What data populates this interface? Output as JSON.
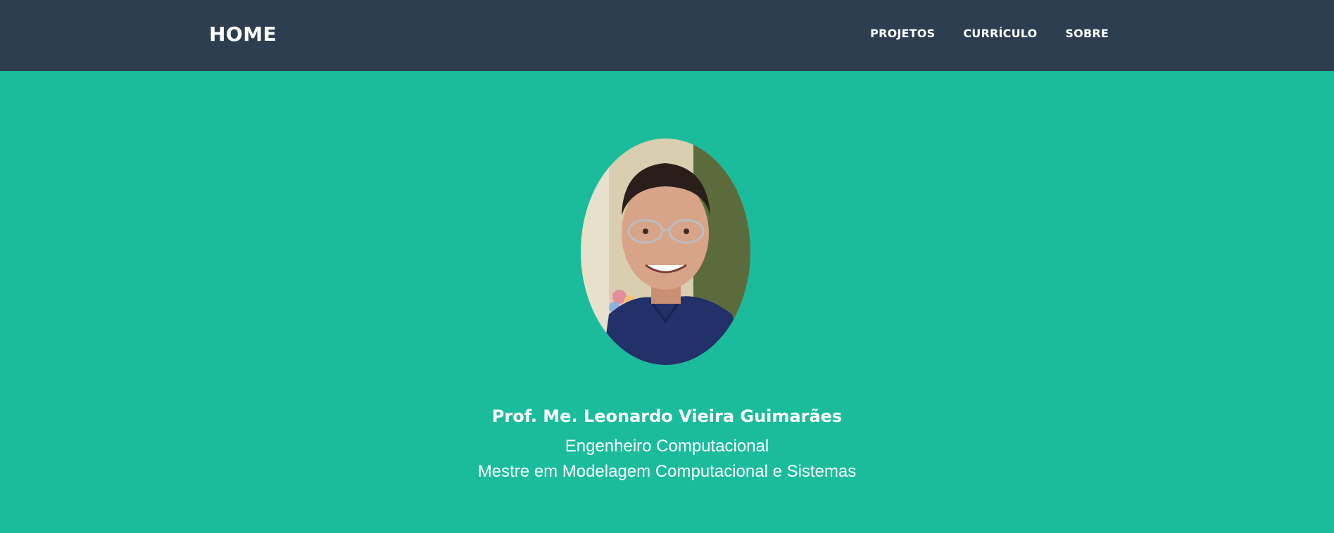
{
  "navbar": {
    "brand": "HOME",
    "links": [
      {
        "label": "PROJETOS"
      },
      {
        "label": "CURRÍCULO"
      },
      {
        "label": "SOBRE"
      }
    ]
  },
  "profile": {
    "name": "Prof. Me. Leonardo Vieira Guimarães",
    "subtitle_1": "Engenheiro Computacional",
    "subtitle_2": "Mestre em Modelagem Computacional e Sistemas"
  },
  "colors": {
    "navbar_bg": "#2c3e50",
    "hero_bg": "#1abc9c",
    "text": "#ffffff"
  }
}
